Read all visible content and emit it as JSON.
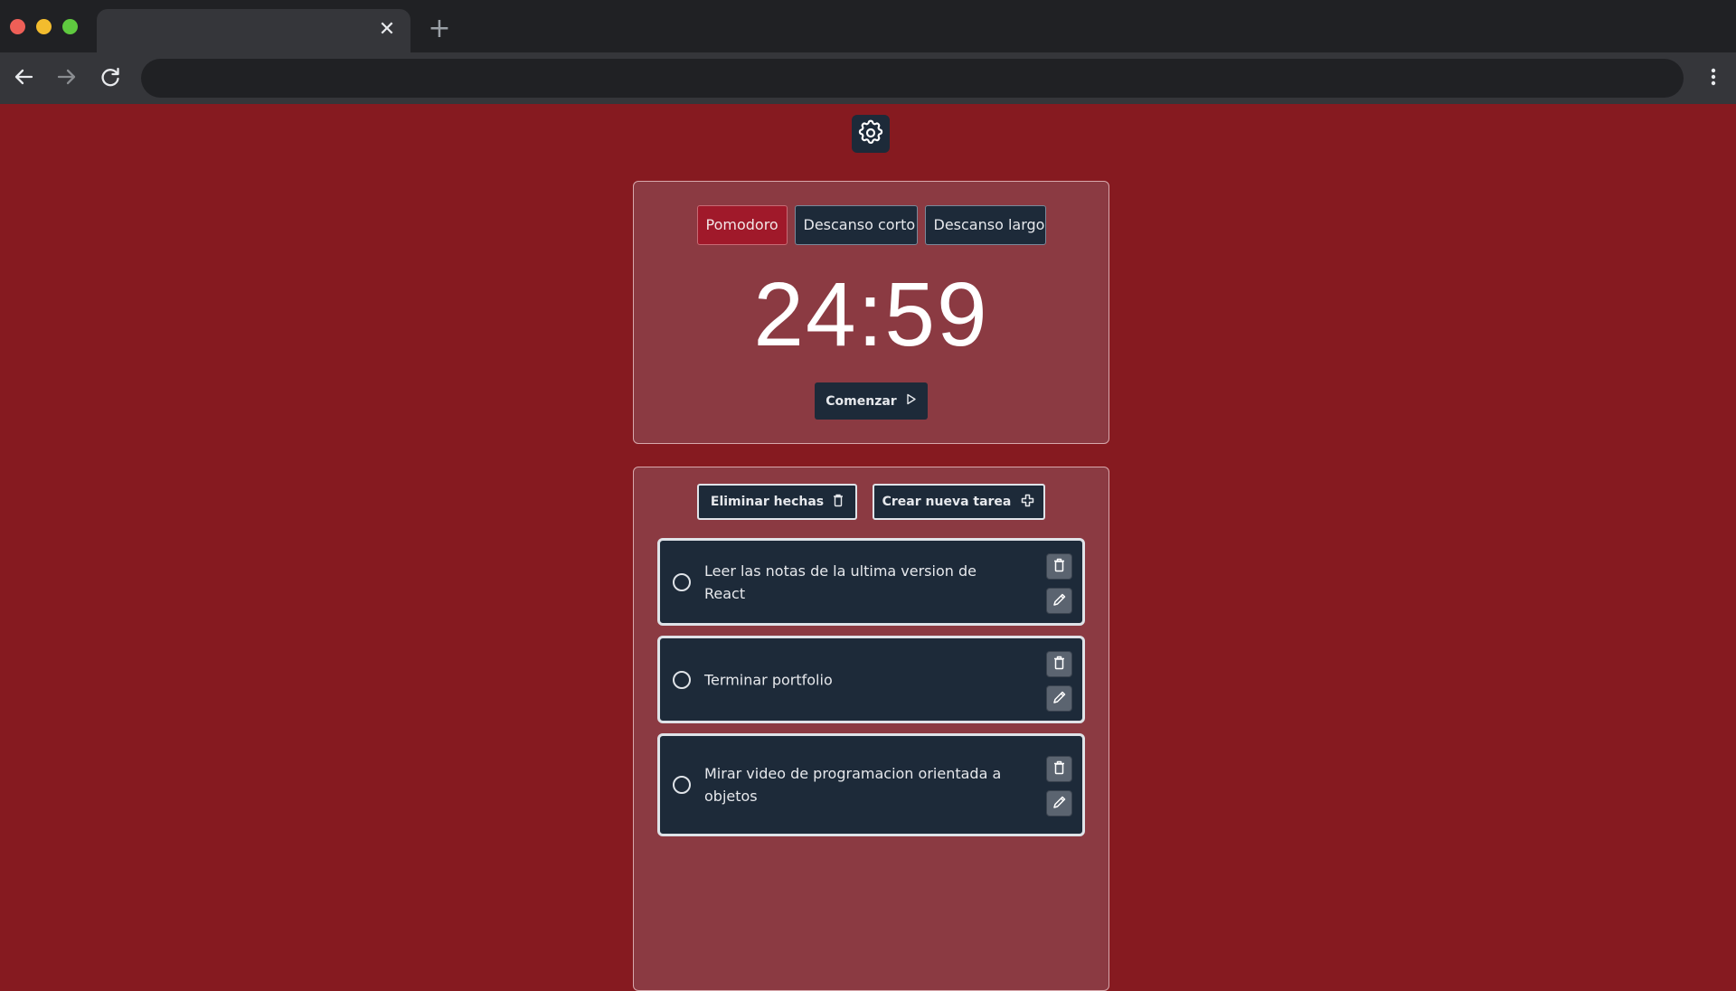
{
  "browser": {
    "tab_close_glyph": "✕",
    "new_tab_glyph": "+"
  },
  "timer": {
    "modes": [
      {
        "label": "Pomodoro",
        "active": true
      },
      {
        "label": "Descanso corto",
        "active": false
      },
      {
        "label": "Descanso largo",
        "active": false
      }
    ],
    "time": "24:59",
    "start_label": "Comenzar"
  },
  "tasks": {
    "delete_done_label": "Eliminar hechas",
    "create_label": "Crear nueva tarea",
    "items": [
      {
        "text": "Leer las notas de la ultima version de React",
        "done": false
      },
      {
        "text": "Terminar portfolio",
        "done": false
      },
      {
        "text": "Mirar video de programacion orientada a objetos",
        "done": false
      }
    ]
  },
  "colors": {
    "page_background": "#861a20",
    "card_background": "#8b3a42",
    "dark_button": "#1d2a39",
    "active_mode": "#a0192a"
  },
  "icons": {
    "settings": "gear-icon",
    "start": "play-icon",
    "delete_done": "trash-icon",
    "create": "plus-circle-icon",
    "task_delete": "trash-icon",
    "task_edit": "pencil-icon"
  }
}
